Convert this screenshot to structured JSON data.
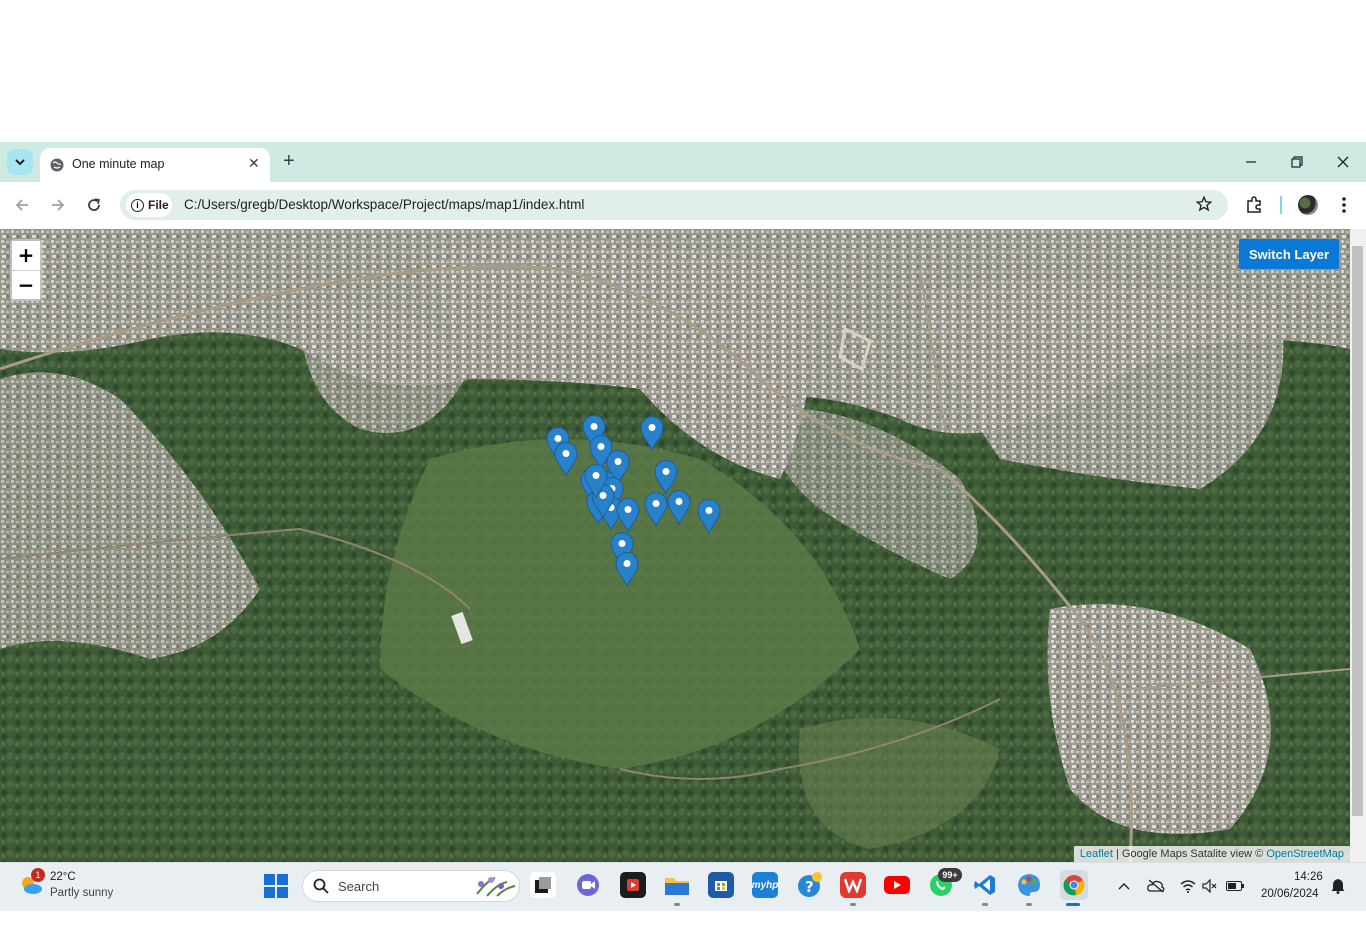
{
  "browser": {
    "tab_title": "One minute map",
    "new_tab_symbol": "+",
    "close_tab_symbol": "✕",
    "site_chip_label": "File",
    "url": "C:/Users/gregb/Desktop/Workspace/Project/maps/map1/index.html",
    "icons": [
      "tab-search-icon",
      "globe-icon",
      "back-icon",
      "forward-icon",
      "reload-icon",
      "info-icon",
      "star-icon",
      "extensions-icon",
      "profile-avatar",
      "kebab-menu-icon",
      "minimize-icon",
      "restore-icon",
      "close-icon"
    ]
  },
  "map": {
    "zoom_in_label": "+",
    "zoom_out_label": "−",
    "switch_layer_label": "Switch Layer",
    "attribution": {
      "leaflet": "Leaflet",
      "separator": " | Google Maps Satalite view © ",
      "osm": "OpenStreetMap"
    },
    "marker_count": 20,
    "colors": {
      "marker": "#2a81cb",
      "button": "#0a78d6"
    }
  },
  "taskbar": {
    "weather": {
      "temp": "22°C",
      "desc": "Partly sunny",
      "badge": "1"
    },
    "search_placeholder": "Search",
    "apps": [
      "start-icon",
      "task-view-icon",
      "meet-icon",
      "video-editor-icon",
      "file-explorer-icon",
      "store-icon",
      "myhp-icon",
      "help-icon",
      "wps-icon",
      "youtube-icon",
      "whatsapp-icon",
      "vscode-icon",
      "paint-icon",
      "chrome-icon"
    ],
    "whatsapp_badge": "99+",
    "myhp_label": "myhp",
    "clock": {
      "time": "14:26",
      "date": "20/06/2024"
    }
  }
}
